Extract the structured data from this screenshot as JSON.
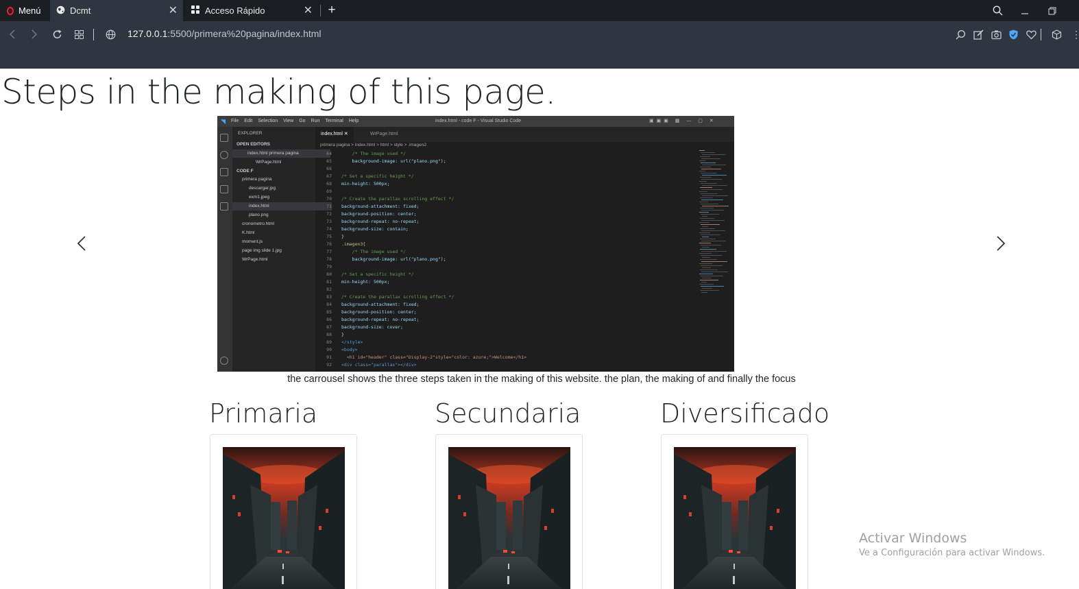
{
  "browser": {
    "menu_label": "Menú",
    "tabs": [
      {
        "label": "Dcmt",
        "icon": "globe-icon"
      },
      {
        "label": "Acceso Rápido",
        "icon": "grid-icon"
      }
    ],
    "url_host": "127.0.0.1",
    "url_rest": ":5500/primera%20pagina/index.html"
  },
  "page": {
    "title": "Steps in the making of this page.",
    "carousel_caption": "the carrousel shows the three steps taken in the making of this website. the plan, the making of and finally the focus",
    "columns": [
      {
        "title": "Primaria"
      },
      {
        "title": "Secundaria"
      },
      {
        "title": "Diversificado"
      }
    ]
  },
  "slide": {
    "menu": [
      "File",
      "Edit",
      "Selection",
      "View",
      "Go",
      "Run",
      "Terminal",
      "Help"
    ],
    "window_title": "index.html - code F - Visual Studio Code",
    "tabs": [
      "index.html",
      "WrPage.html"
    ],
    "breadcrumb": "primera pagina > index.html > html > style > .imagen2",
    "explorer": {
      "header": "EXPLORER",
      "open_editors": "OPEN EDITORS",
      "open_files": [
        "index.html  primera pagina",
        "WrPage.html"
      ],
      "workspace": "CODE F",
      "folder": "primera pagina",
      "files": [
        "descargar.jpg",
        "exm1.jpeg",
        "index.html",
        "plano.png",
        "cronometro.html",
        "K.html",
        "moment.js",
        "page img slide 1.jpg",
        "WrPage.html"
      ]
    },
    "code": [
      {
        "n": "64",
        "t": "    /* The image used */",
        "k": "c-com"
      },
      {
        "n": "65",
        "t": "    background-image: url(\"plano.png\");",
        "k": "c-prop"
      },
      {
        "n": "66",
        "t": "",
        "k": "c-txt"
      },
      {
        "n": "67",
        "t": "/* Set a specific height */",
        "k": "c-com"
      },
      {
        "n": "68",
        "t": "min-height: 500px;",
        "k": "c-prop"
      },
      {
        "n": "69",
        "t": "",
        "k": "c-txt"
      },
      {
        "n": "70",
        "t": "/* Create the parallax scrolling effect */",
        "k": "c-com"
      },
      {
        "n": "71",
        "t": "background-attachment: fixed;",
        "k": "c-prop"
      },
      {
        "n": "72",
        "t": "background-position: center;",
        "k": "c-prop"
      },
      {
        "n": "73",
        "t": "background-repeat: no-repeat;",
        "k": "c-prop"
      },
      {
        "n": "74",
        "t": "background-size: contain;",
        "k": "c-prop"
      },
      {
        "n": "75",
        "t": "}",
        "k": "c-txt"
      },
      {
        "n": "76",
        "t": ".imagen3{",
        "k": "c-sel"
      },
      {
        "n": "77",
        "t": "    /* The image used */",
        "k": "c-com"
      },
      {
        "n": "78",
        "t": "    background-image: url(\"plano.png\");",
        "k": "c-prop"
      },
      {
        "n": "79",
        "t": "",
        "k": "c-txt"
      },
      {
        "n": "80",
        "t": "/* Set a specific height */",
        "k": "c-com"
      },
      {
        "n": "81",
        "t": "min-height: 500px;",
        "k": "c-prop"
      },
      {
        "n": "82",
        "t": "",
        "k": "c-txt"
      },
      {
        "n": "83",
        "t": "/* Create the parallax scrolling effect */",
        "k": "c-com"
      },
      {
        "n": "84",
        "t": "background-attachment: fixed;",
        "k": "c-prop"
      },
      {
        "n": "85",
        "t": "background-position: center;",
        "k": "c-prop"
      },
      {
        "n": "86",
        "t": "background-repeat: no-repeat;",
        "k": "c-prop"
      },
      {
        "n": "87",
        "t": "background-size: cover;",
        "k": "c-prop"
      },
      {
        "n": "88",
        "t": "}",
        "k": "c-txt"
      },
      {
        "n": "89",
        "t": "</style>",
        "k": "c-tag"
      },
      {
        "n": "90",
        "t": "<body>",
        "k": "c-tag"
      },
      {
        "n": "91",
        "t": "  <h1 id=\"header\" class=\"Display-2\"style=\"color: azure;\">Welcome</h1>",
        "k": "c-val"
      },
      {
        "n": "92",
        "t": "<div class=\"parallax\"></div>",
        "k": "c-tag"
      }
    ]
  },
  "watermark": {
    "title": "Activar Windows",
    "subtitle": "Ve a Configuración para activar Windows."
  }
}
